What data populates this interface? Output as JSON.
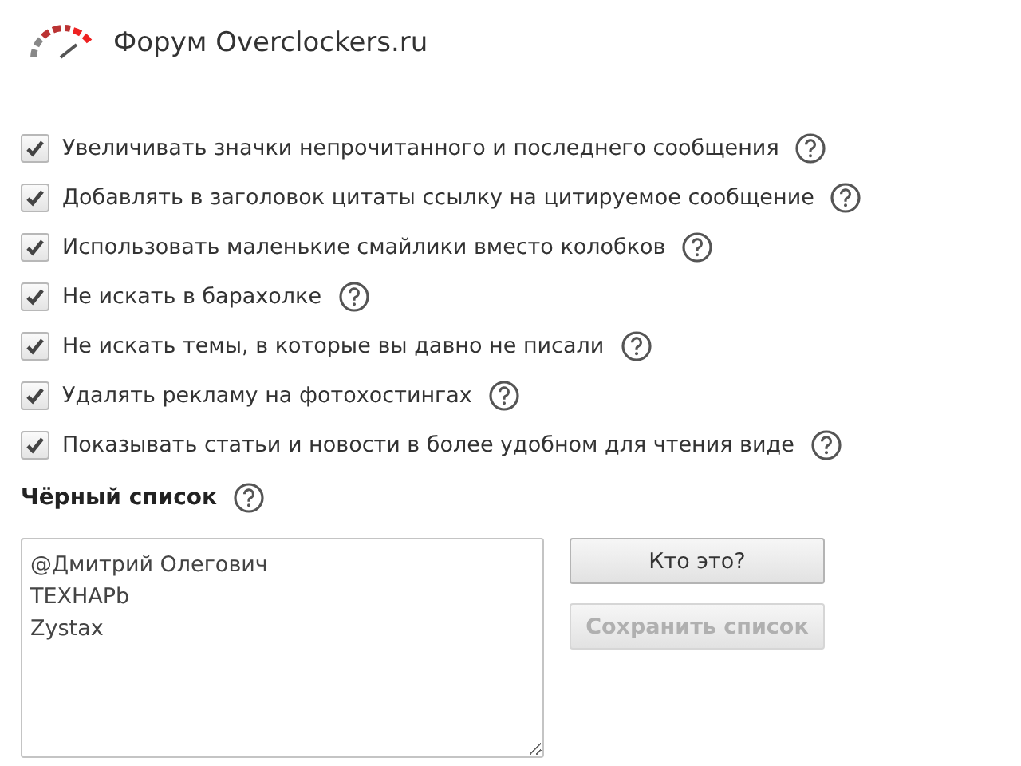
{
  "header": {
    "title": "Форум Overclockers.ru"
  },
  "options": [
    {
      "label": "Увеличивать значки непрочитанного и последнего сообщения",
      "checked": true
    },
    {
      "label": "Добавлять в заголовок цитаты ссылку на цитируемое сообщение",
      "checked": true
    },
    {
      "label": "Использовать маленькие смайлики вместо колобков",
      "checked": true
    },
    {
      "label": "Не искать в барахолке",
      "checked": true
    },
    {
      "label": "Не искать темы, в которые вы давно не писали",
      "checked": true
    },
    {
      "label": "Удалять рекламу на фотохостингах",
      "checked": true
    },
    {
      "label": "Показывать статьи и новости в более удобном для чтения виде",
      "checked": true
    }
  ],
  "blacklist": {
    "title": "Чёрный список",
    "entries": [
      "@Дмитрий Олегович",
      "ТЕХНАРb",
      "Zystax"
    ],
    "buttons": [
      {
        "label": "Кто это?",
        "disabled": false
      },
      {
        "label": "Сохранить список",
        "disabled": true
      }
    ]
  }
}
